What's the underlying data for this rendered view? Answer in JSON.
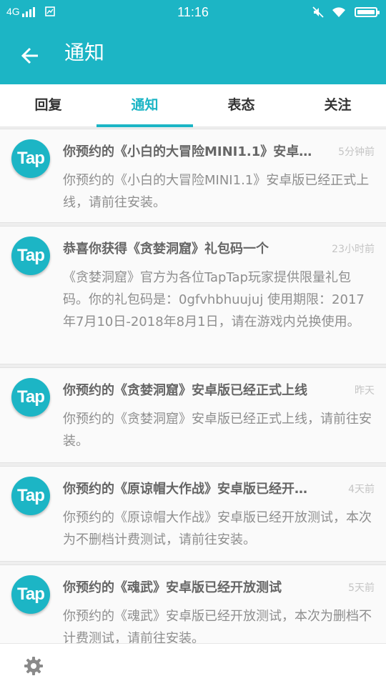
{
  "status_bar": {
    "network": "4G",
    "time": "11:16",
    "icons": [
      "signal-icon",
      "image-icon",
      "mute-icon",
      "wifi-icon",
      "battery-icon"
    ]
  },
  "header": {
    "title": "通知",
    "back_icon": "arrow-left-icon"
  },
  "tabs": [
    {
      "label": "回复",
      "active": false
    },
    {
      "label": "通知",
      "active": true
    },
    {
      "label": "表态",
      "active": false
    },
    {
      "label": "关注",
      "active": false
    }
  ],
  "notifications": [
    {
      "avatar_text": "Tap",
      "title": "你预约的《小白的大冒险MINI1.1》安卓…",
      "time": "5分钟前",
      "body": "你预约的《小白的大冒险MINI1.1》安卓版已经正式上线，请前往安装。"
    },
    {
      "avatar_text": "Tap",
      "title": "恭喜你获得《贪婪洞窟》礼包码一个",
      "time": "23小时前",
      "body": "《贪婪洞窟》官方为各位TapTap玩家提供限量礼包码。你的礼包码是：0gfvhbhuujuj 使用期限：2017年7月10日-2018年8月1日，请在游戏内兑换使用。"
    },
    {
      "avatar_text": "Tap",
      "title": "你预约的《贪婪洞窟》安卓版已经正式上线",
      "time": "昨天",
      "body": "你预约的《贪婪洞窟》安卓版已经正式上线，请前往安装。"
    },
    {
      "avatar_text": "Tap",
      "title": "你预约的《原谅帽大作战》安卓版已经开…",
      "time": "4天前",
      "body": "你预约的《原谅帽大作战》安卓版已经开放测试，本次为不删档计费测试，请前往安装。"
    },
    {
      "avatar_text": "Tap",
      "title": "你预约的《魂武》安卓版已经开放测试",
      "time": "5天前",
      "body": "你预约的《魂武》安卓版已经开放测试，本次为删档不计费测试，请前往安装。"
    }
  ],
  "bottom_bar": {
    "settings_icon": "gear-icon"
  },
  "colors": {
    "accent": "#1cb5c5",
    "card_bg": "#fafafa",
    "title_text": "#666666",
    "body_text": "#8e8e8e",
    "time_text": "#c4c4c4"
  }
}
